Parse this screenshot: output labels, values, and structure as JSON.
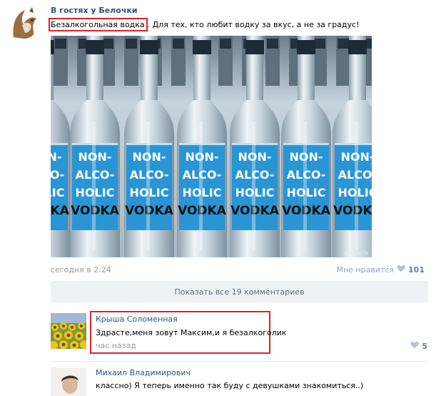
{
  "post": {
    "author": "В гостях у Белочки",
    "text_highlighted": "Безалкогольная водка",
    "text_rest": ". Для тех, кто любит водку за вкус, а не за градус!",
    "photo_label_lines": [
      "NON-",
      "ALCO-",
      "HOLIC",
      "VODKA"
    ],
    "watermark": "pikabu.ru",
    "date": "сегодня в 2:24",
    "like_label": "Мне нравится",
    "like_count": "101",
    "show_comments_label": "Показать все 19 комментариев"
  },
  "comments": [
    {
      "author": "Крыша Соломенная",
      "text": "Здрасте,меня зовут Максим,и я безалкоголик",
      "time": "час назад",
      "likes": "5"
    },
    {
      "author": "Михаил Владимирович",
      "text": "классно) Я теперь именно так буду с девушками знакомиться..)"
    }
  ],
  "colors": {
    "link": "#2b587a",
    "highlight_border": "#d9242b",
    "muted": "#999999",
    "button_bg": "#eef2f5",
    "label_blue": "#2a95d4"
  },
  "icons": {
    "like": "heart-icon"
  }
}
